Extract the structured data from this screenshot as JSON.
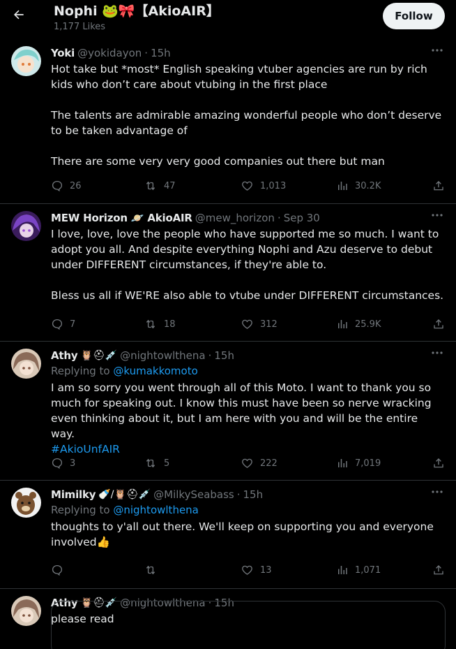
{
  "header": {
    "title": "Nophi 🐸🎀【AkioAIR】",
    "likes": "1,177 Likes",
    "follow_label": "Follow"
  },
  "tweets": [
    {
      "display_name": "Yoki",
      "handle": "@yokidayon",
      "time": "15h",
      "paragraphs": [
        "Hot take but *most* English speaking vtuber agencies are run by rich kids who don’t care about vtubing in the first place",
        "The talents are admirable amazing wonderful people who don’t deserve to be taken advantage of",
        "There are some very very good companies out there but man"
      ],
      "replies": "26",
      "retweets": "47",
      "likes": "1,013",
      "views": "30.2K"
    },
    {
      "display_name": "MEW Horizon 🪐 AkioAIR",
      "handle": "@mew_horizon",
      "time": "Sep 30",
      "paragraphs": [
        "I love, love, love the people who have supported me so much. I want to adopt you all. And despite everything Nophi and Azu deserve to debut under DIFFERENT circumstances, if they're able to.",
        "Bless us all if WE'RE also able to vtube under DIFFERENT circumstances."
      ],
      "replies": "7",
      "retweets": "18",
      "likes": "312",
      "views": "25.9K"
    },
    {
      "display_name": "Athy",
      "name_emoji": "🦉⛑💉",
      "handle": "@nightowlthena",
      "time": "15h",
      "replying_prefix": "Replying to",
      "replying_to": "@kumakkomoto",
      "text": "I am so sorry you went through all of this Moto. I want to thank you so much for speaking out. I know this must have been so nerve wracking even thinking about it, but I am here with you and will be the entire way.",
      "hashtag": "#AkioUnfAIR",
      "replies": "3",
      "retweets": "5",
      "likes": "222",
      "views": "7,019"
    },
    {
      "display_name": "Mimilky",
      "name_emoji": "🍼/🦉⛑💉",
      "handle": "@MilkySeabass",
      "time": "15h",
      "replying_prefix": "Replying to",
      "replying_to": "@nightowlthena",
      "text": "thoughts to y'all out there. We'll keep on supporting you and everyone involved👍",
      "replies": "",
      "retweets": "",
      "likes": "13",
      "views": "1,071"
    },
    {
      "display_name": "Athy",
      "name_emoji": "🦉⛑💉",
      "handle": "@nightowlthena",
      "time": "15h",
      "text": "please read"
    }
  ],
  "separator": "·",
  "icons": {
    "back": "arrow-left-icon",
    "more": "more-dots-icon",
    "reply": "reply-bubble-icon",
    "retweet": "retweet-icon",
    "like": "heart-icon",
    "views": "views-bars-icon",
    "share": "share-upload-icon"
  },
  "colors": {
    "background": "#000000",
    "text": "#e7e9ea",
    "muted": "#71767b",
    "link": "#1d9bf0",
    "divider": "#2f3336",
    "follow_bg": "#eff3f4"
  }
}
